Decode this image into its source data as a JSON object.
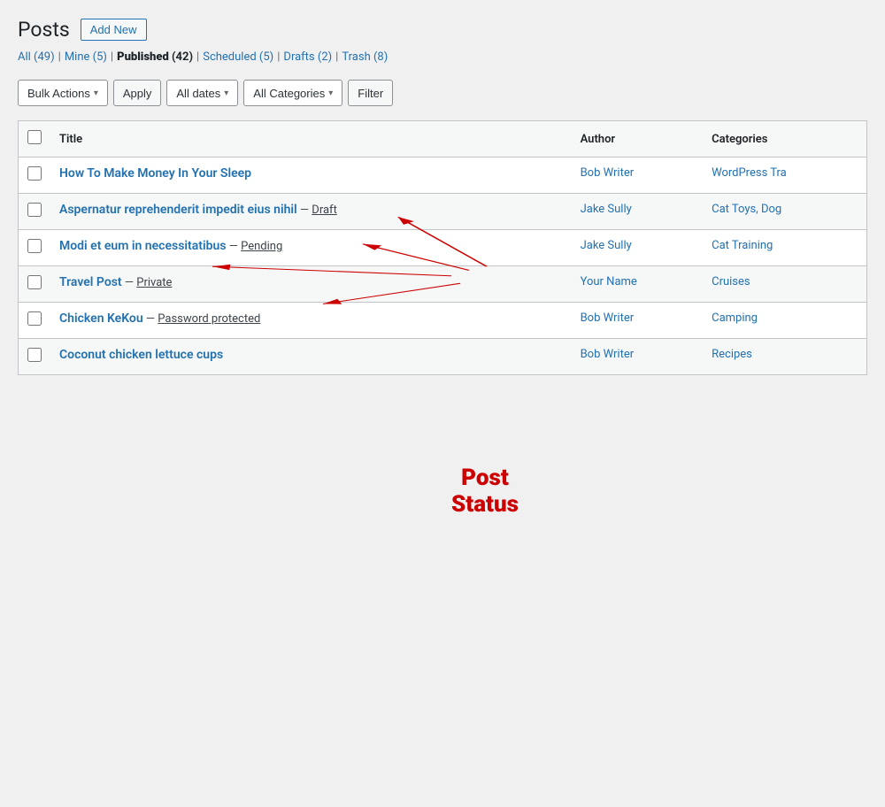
{
  "page": {
    "title": "Posts",
    "add_new_label": "Add New"
  },
  "filter_tabs": [
    {
      "label": "All",
      "count": "(49)",
      "active": false
    },
    {
      "label": "Mine",
      "count": "(5)",
      "active": false
    },
    {
      "label": "Published",
      "count": "(42)",
      "active": true
    },
    {
      "label": "Scheduled",
      "count": "(5)",
      "active": false
    },
    {
      "label": "Drafts",
      "count": "(2)",
      "active": false
    },
    {
      "label": "Trash",
      "count": "(8)",
      "active": false
    }
  ],
  "toolbar": {
    "bulk_actions_label": "Bulk Actions",
    "apply_label": "Apply",
    "all_dates_label": "All dates",
    "all_categories_label": "All Categories",
    "filter_label": "Filter"
  },
  "table": {
    "columns": [
      "Title",
      "Author",
      "Categories"
    ],
    "rows": [
      {
        "title": "How To Make Money In Your Sleep",
        "status": null,
        "status_text": null,
        "author": "Bob Writer",
        "category": "WordPress Tra"
      },
      {
        "title": "Aspernatur reprehenderit impedit eius nihil",
        "status": "Draft",
        "status_text": "Draft",
        "author": "Jake Sully",
        "category": "Cat Toys, Dog"
      },
      {
        "title": "Modi et eum in necessitatibus",
        "status": "Pending",
        "status_text": "Pending",
        "author": "Jake Sully",
        "category": "Cat Training"
      },
      {
        "title": "Travel Post",
        "status": "Private",
        "status_text": "Private",
        "author": "Your Name",
        "category": "Cruises"
      },
      {
        "title": "Chicken KeKou",
        "status": "Password protected",
        "status_text": "Password protected",
        "author": "Bob Writer",
        "category": "Camping"
      },
      {
        "title": "Coconut chicken lettuce cups",
        "status": null,
        "status_text": null,
        "author": "Bob Writer",
        "category": "Recipes"
      }
    ]
  },
  "annotation": {
    "label_line1": "Post",
    "label_line2": "Status"
  },
  "colors": {
    "accent": "#2271b1",
    "red_annotation": "#cc0000",
    "border": "#c3c4c7"
  }
}
